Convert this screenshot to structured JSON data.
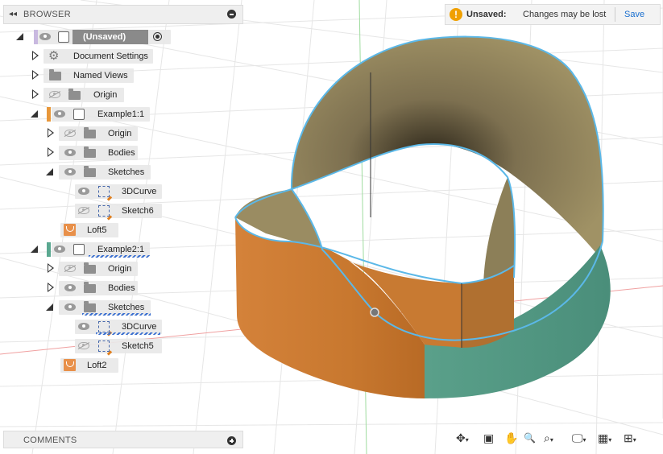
{
  "browser": {
    "collapse_glyph": "◂◂",
    "title": "BROWSER",
    "root_label": "(Unsaved)",
    "items": [
      {
        "label": "Document Settings"
      },
      {
        "label": "Named Views"
      },
      {
        "label": "Origin"
      },
      {
        "label": "Example1:1"
      },
      {
        "label": "Origin"
      },
      {
        "label": "Bodies"
      },
      {
        "label": "Sketches"
      },
      {
        "label": "3DCurve"
      },
      {
        "label": "Sketch6"
      },
      {
        "label": "Loft5"
      },
      {
        "label": "Example2:1"
      },
      {
        "label": "Origin"
      },
      {
        "label": "Bodies"
      },
      {
        "label": "Sketches"
      },
      {
        "label": "3DCurve"
      },
      {
        "label": "Sketch5"
      },
      {
        "label": "Loft2"
      }
    ]
  },
  "banner": {
    "warning_glyph": "!",
    "status": "Unsaved:",
    "message": "Changes may be lost",
    "save_label": "Save"
  },
  "comments": {
    "title": "COMMENTS"
  },
  "colors": {
    "accent": "#1a6fcf",
    "example1": "#e8973a",
    "example2": "#5aa890",
    "surface_orange": "#d88a3a",
    "surface_green": "#4e9a86",
    "surface_inner": "#9a8c60",
    "edge": "#5bb8e8"
  },
  "toolbar": {
    "icons": [
      "orbit-icon",
      "look-at-icon",
      "pan-icon",
      "zoom-icon",
      "fit-icon",
      "display-settings-icon",
      "grid-settings-icon",
      "viewports-icon"
    ],
    "glyphs": [
      "✥",
      "▣",
      "✋",
      "🔍",
      "⌕",
      "🖵",
      "▦",
      "⊞"
    ]
  }
}
